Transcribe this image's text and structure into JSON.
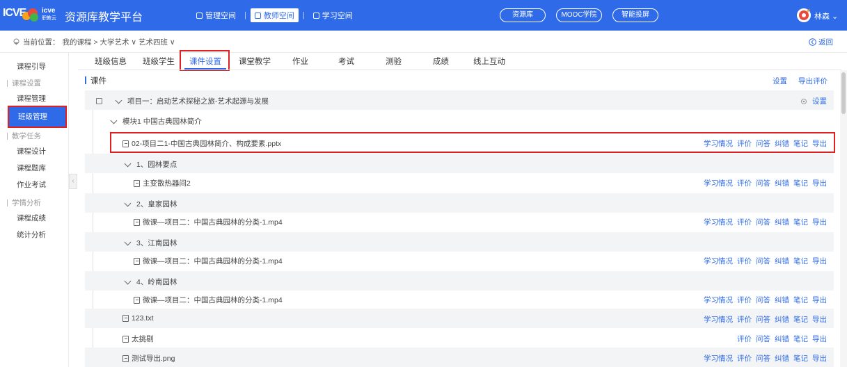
{
  "header": {
    "logo_mark": "ICVE",
    "logo_small_top": "icve",
    "logo_small_bottom": "职教云",
    "title": "资源库教学平台",
    "spaces": [
      {
        "label": "管理空间"
      },
      {
        "label": "教师空间"
      },
      {
        "label": "学习空间"
      }
    ],
    "pills": [
      "资源库",
      "MOOC学院",
      "智能投屏"
    ],
    "user_name": "林森 ⌄"
  },
  "breadcrumb": {
    "prefix": "当前位置：",
    "path": "我的课程 > 大学艺术 ∨  艺术四班 ∨",
    "back": "返回"
  },
  "sidebar": {
    "items": [
      {
        "label": "课程引导",
        "type": "item"
      },
      {
        "label": "课程设置",
        "type": "group"
      },
      {
        "label": "课程管理",
        "type": "item"
      },
      {
        "label": "班级管理",
        "type": "item",
        "active": true
      },
      {
        "label": "教学任务",
        "type": "group"
      },
      {
        "label": "课程设计",
        "type": "item"
      },
      {
        "label": "课程题库",
        "type": "item"
      },
      {
        "label": "作业考试",
        "type": "item"
      },
      {
        "label": "学情分析",
        "type": "group"
      },
      {
        "label": "课程成绩",
        "type": "item"
      },
      {
        "label": "统计分析",
        "type": "item"
      }
    ]
  },
  "tabs": [
    "班级信息",
    "班级学生",
    "课件设置",
    "课堂教学",
    "作业",
    "考试",
    "测验",
    "成绩",
    "线上互动"
  ],
  "active_tab": "课件设置",
  "section": {
    "title": "课件",
    "settings": "设置",
    "export_eval": "导出评价"
  },
  "rows": [
    {
      "kind": "project",
      "label": "项目一：启动艺术探秘之旅-艺术起源与发展",
      "action": "设置"
    },
    {
      "kind": "module",
      "label": "模块1 中国古典园林简介"
    },
    {
      "kind": "file",
      "label": "02-项目二1-中国古典园林简介、构成要素.pptx",
      "actions": [
        "学习情况",
        "评价",
        "问答",
        "纠错",
        "笔记",
        "导出"
      ]
    },
    {
      "kind": "topic",
      "label": "1、园林要点"
    },
    {
      "kind": "file",
      "label": "主变散热器间2",
      "actions": [
        "学习情况",
        "评价",
        "问答",
        "纠错",
        "笔记",
        "导出"
      ]
    },
    {
      "kind": "topic",
      "label": "2、皇家园林"
    },
    {
      "kind": "file",
      "label": "微课—项目二：中国古典园林的分类-1.mp4",
      "actions": [
        "学习情况",
        "评价",
        "问答",
        "纠错",
        "笔记",
        "导出"
      ]
    },
    {
      "kind": "topic",
      "label": "3、江南园林"
    },
    {
      "kind": "file",
      "label": "微课—项目二：中国古典园林的分类-1.mp4",
      "actions": [
        "学习情况",
        "评价",
        "问答",
        "纠错",
        "笔记",
        "导出"
      ]
    },
    {
      "kind": "topic",
      "label": "4、岭南园林"
    },
    {
      "kind": "file",
      "label": "微课—项目二：中国古典园林的分类-1.mp4",
      "actions": [
        "学习情况",
        "评价",
        "问答",
        "纠错",
        "笔记",
        "导出"
      ]
    },
    {
      "kind": "file",
      "label": "123.txt",
      "actions": [
        "学习情况",
        "评价",
        "问答",
        "纠错",
        "笔记",
        "导出"
      ]
    },
    {
      "kind": "file",
      "label": "太挑剔",
      "actions": [
        "评价",
        "问答",
        "纠错",
        "笔记",
        "导出"
      ]
    },
    {
      "kind": "file",
      "label": "测试导出.png",
      "actions": [
        "学习情况",
        "评价",
        "问答",
        "纠错",
        "笔记",
        "导出"
      ]
    }
  ],
  "colors": {
    "primary": "#2f6be8",
    "highlight": "#e02020",
    "row_grey": "#f3f4f6"
  }
}
